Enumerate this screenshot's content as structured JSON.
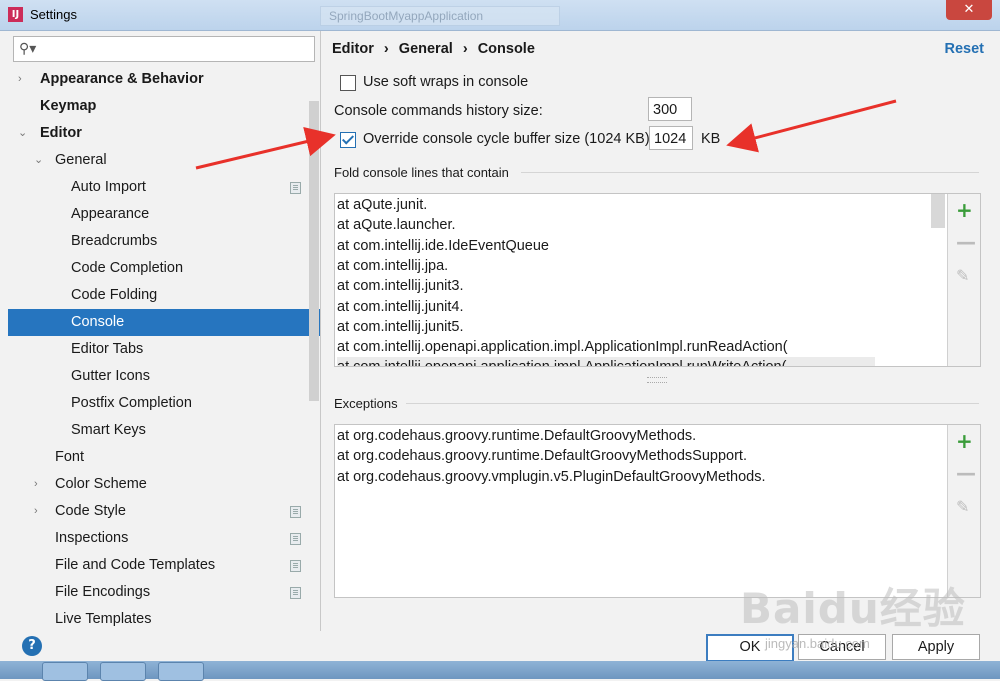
{
  "window": {
    "title": "Settings",
    "app_icon_letter": "IJ",
    "ghost_tab": "SpringBootMyappApplication",
    "close_glyph": "✕"
  },
  "search": {
    "placeholder": "",
    "icon": "search-icon"
  },
  "tree": [
    {
      "label": "Appearance & Behavior",
      "bold": true,
      "arrow": "›",
      "indent": 0,
      "page": false
    },
    {
      "label": "Keymap",
      "bold": true,
      "arrow": "",
      "indent": 0,
      "page": false
    },
    {
      "label": "Editor",
      "bold": true,
      "arrow": "⌄",
      "indent": 0,
      "page": false
    },
    {
      "label": "General",
      "bold": false,
      "arrow": "⌄",
      "indent": 1,
      "page": false
    },
    {
      "label": "Auto Import",
      "bold": false,
      "arrow": "",
      "indent": 2,
      "page": true
    },
    {
      "label": "Appearance",
      "bold": false,
      "arrow": "",
      "indent": 2,
      "page": false
    },
    {
      "label": "Breadcrumbs",
      "bold": false,
      "arrow": "",
      "indent": 2,
      "page": false
    },
    {
      "label": "Code Completion",
      "bold": false,
      "arrow": "",
      "indent": 2,
      "page": false
    },
    {
      "label": "Code Folding",
      "bold": false,
      "arrow": "",
      "indent": 2,
      "page": false
    },
    {
      "label": "Console",
      "bold": false,
      "arrow": "",
      "indent": 2,
      "page": false,
      "selected": true
    },
    {
      "label": "Editor Tabs",
      "bold": false,
      "arrow": "",
      "indent": 2,
      "page": false
    },
    {
      "label": "Gutter Icons",
      "bold": false,
      "arrow": "",
      "indent": 2,
      "page": false
    },
    {
      "label": "Postfix Completion",
      "bold": false,
      "arrow": "",
      "indent": 2,
      "page": false
    },
    {
      "label": "Smart Keys",
      "bold": false,
      "arrow": "",
      "indent": 2,
      "page": false
    },
    {
      "label": "Font",
      "bold": false,
      "arrow": "",
      "indent": 1,
      "page": false
    },
    {
      "label": "Color Scheme",
      "bold": false,
      "arrow": "›",
      "indent": 1,
      "page": false
    },
    {
      "label": "Code Style",
      "bold": false,
      "arrow": "›",
      "indent": 1,
      "page": true
    },
    {
      "label": "Inspections",
      "bold": false,
      "arrow": "",
      "indent": 1,
      "page": true
    },
    {
      "label": "File and Code Templates",
      "bold": false,
      "arrow": "",
      "indent": 1,
      "page": true
    },
    {
      "label": "File Encodings",
      "bold": false,
      "arrow": "",
      "indent": 1,
      "page": true
    },
    {
      "label": "Live Templates",
      "bold": false,
      "arrow": "",
      "indent": 1,
      "page": false
    }
  ],
  "breadcrumb": [
    "Editor",
    "General",
    "Console"
  ],
  "breadcrumb_sep": "›",
  "reset_label": "Reset",
  "options": {
    "soft_wraps_label": "Use soft wraps in console",
    "soft_wraps_checked": false,
    "history_label": "Console commands history size:",
    "history_value": "300",
    "override_label": "Override console cycle buffer size (1024 KB)",
    "override_checked": true,
    "override_value": "1024",
    "override_unit": "KB"
  },
  "fold": {
    "title": "Fold console lines that contain",
    "items": [
      "at aQute.junit.",
      "at aQute.launcher.",
      "at com.intellij.ide.IdeEventQueue",
      "at com.intellij.jpa.",
      "at com.intellij.junit3.",
      "at com.intellij.junit4.",
      "at com.intellij.junit5.",
      "at com.intellij.openapi.application.impl.ApplicationImpl.runReadAction(",
      "at com.intellij.openapi.application.impl.ApplicationImpl.runWriteAction("
    ]
  },
  "exceptions": {
    "title": "Exceptions",
    "items": [
      "at org.codehaus.groovy.runtime.DefaultGroovyMethods.",
      "at org.codehaus.groovy.runtime.DefaultGroovyMethodsSupport.",
      "at org.codehaus.groovy.vmplugin.v5.PluginDefaultGroovyMethods."
    ]
  },
  "list_buttons": {
    "add": "+",
    "remove": "—",
    "edit": "✎"
  },
  "footer": {
    "help": "?",
    "ok": "OK",
    "cancel": "Cancel",
    "apply": "Apply"
  },
  "watermark": {
    "text": "Baidu经验",
    "sub": "jingyan.baidu.com"
  },
  "colors": {
    "selection": "#2675bf",
    "accent": "#2470b3",
    "arrow": "#e8312a",
    "add": "#3a9c3a"
  }
}
